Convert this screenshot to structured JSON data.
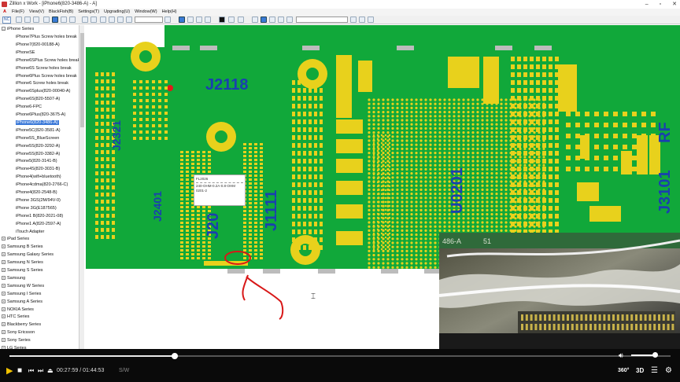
{
  "window": {
    "title": "Zillion x Work - [iPhone6(820-3486-A) - A]",
    "controls": [
      "–",
      "▫",
      "✕"
    ]
  },
  "menu": [
    "File(F)",
    "View(V)",
    "BlackFish(B)",
    "Settings(T)",
    "Upgrading(U)",
    "Window(W)",
    "Help(H)"
  ],
  "toolbar": {
    "nc_label": "NC"
  },
  "sidebar": {
    "root_label": "iPhone Series",
    "items": [
      {
        "label": "iPhone7Plus Screw holes break",
        "selected": false
      },
      {
        "label": "iPhone7(820-00188-A)",
        "selected": false
      },
      {
        "label": "iPhoneSE",
        "selected": false
      },
      {
        "label": "iPhone6SPlus Screw holes break",
        "selected": false
      },
      {
        "label": "iPhone6S Screw holes break",
        "selected": false
      },
      {
        "label": "iPhone6Plus Screw holes break",
        "selected": false
      },
      {
        "label": "iPhone6 Screw holes break",
        "selected": false
      },
      {
        "label": "iPhone6Splus(820-00040-A)",
        "selected": false
      },
      {
        "label": "iPhone6S(820-5507-A)",
        "selected": false
      },
      {
        "label": "iPhone6-FPC",
        "selected": false
      },
      {
        "label": "iPhone6Plus(820-3675-A)",
        "selected": false
      },
      {
        "label": "iPhone6(820-3486-A)",
        "selected": true
      },
      {
        "label": "iPhone5C(820-3581-A)",
        "selected": false
      },
      {
        "label": "iPhone5S_BlueScreen",
        "selected": false
      },
      {
        "label": "iPhone5S(820-3292-A)",
        "selected": false
      },
      {
        "label": "iPhone5S(820-3382-A)",
        "selected": false
      },
      {
        "label": "iPhone5(820-3141-B)",
        "selected": false
      },
      {
        "label": "iPhone4S(820-3031-B)",
        "selected": false
      },
      {
        "label": "iPhone4(wifi+bluetooth)",
        "selected": false
      },
      {
        "label": "iPhone4cdma(820-2766-C)",
        "selected": false
      },
      {
        "label": "iPhone4(820-2548-B)",
        "selected": false
      },
      {
        "label": "iPhone 3GS(2M/94V-0)",
        "selected": false
      },
      {
        "label": "iPhone 3G(E187565)",
        "selected": false
      },
      {
        "label": "iPhone1 B(820-2021-08)",
        "selected": false
      },
      {
        "label": "iPhone1 A(820-2597-A)",
        "selected": false
      },
      {
        "label": "iTouch Adapter",
        "selected": false
      }
    ],
    "series": [
      "iPad Series",
      "Samsung B Series",
      "Samsung Galaxy Series",
      "Samsung N Series",
      "Samsung S Series",
      "Samsung",
      "Samsung W Series",
      "Samsung I Series",
      "Samsung A Series",
      "NOKIA Series",
      "HTC Series",
      "Blackberry Series",
      "Sony Ericsson",
      "Sony Series",
      "LG Series"
    ]
  },
  "board": {
    "labels": [
      "J2118",
      "J2321",
      "J2401",
      "J20",
      "J1111",
      "U0201",
      "J3101",
      "RF"
    ],
    "tooltip": {
      "line1": "FL2026",
      "line2": "240-OHM-0.2A-0.8-OHM",
      "line3": "0201-2"
    },
    "video_text": [
      "486-A",
      "51"
    ]
  },
  "player": {
    "current_time": "00:27:59",
    "separator": "/",
    "total_time": "01:44:53",
    "sw_label": "S/W",
    "progress": 0.25,
    "volume": 0.93,
    "badge_360": "360°",
    "badge_3d": "3D"
  },
  "colors": {
    "pcb": "#11a83a",
    "pad": "#e8d11c",
    "label": "#1a3fb0",
    "selection": "#3a78d8",
    "annotation": "#d81818"
  }
}
